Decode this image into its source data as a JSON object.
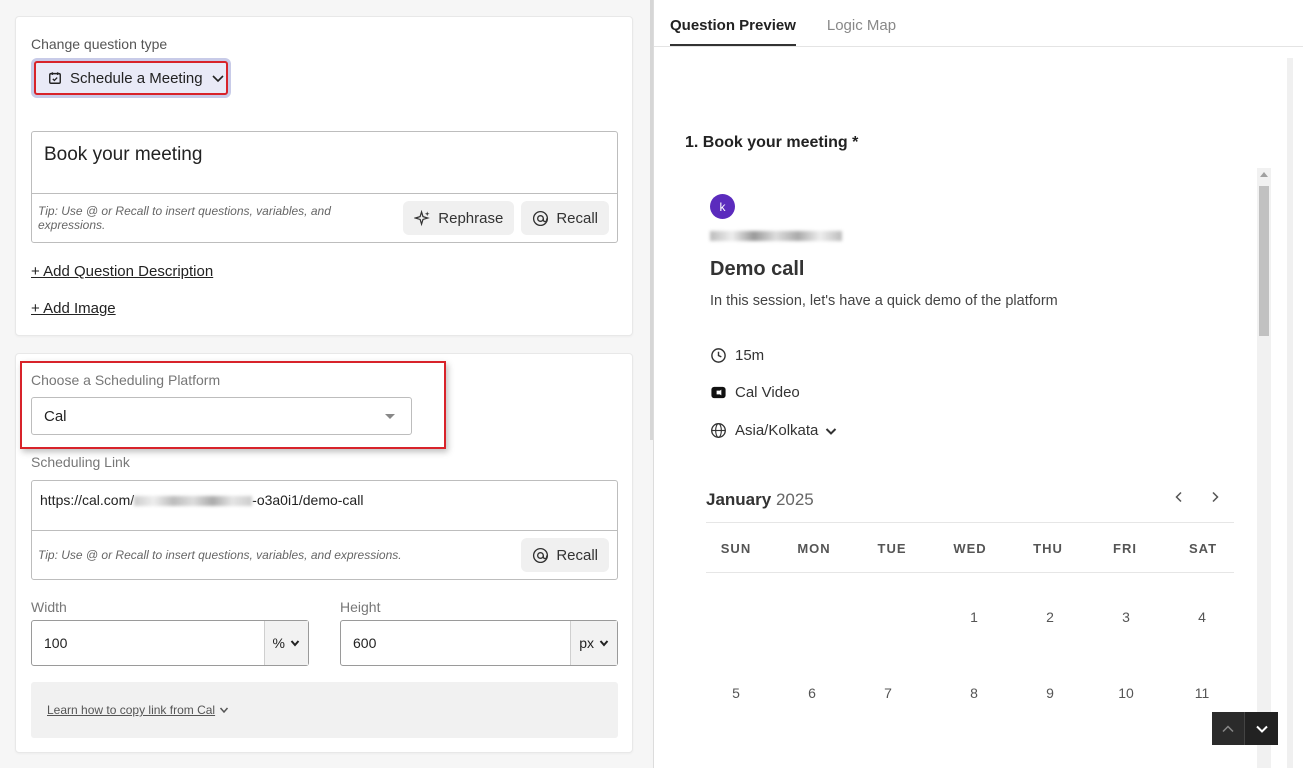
{
  "left": {
    "change_type_label": "Change question type",
    "type_button_label": "Schedule a Meeting",
    "question_text": "Book your meeting",
    "tip": "Tip: Use @ or Recall to insert questions, variables, and expressions.",
    "rephrase_label": "Rephrase",
    "recall_label": "Recall",
    "add_description": "+ Add Question Description",
    "add_image": "+ Add Image",
    "platform_label": "Choose a Scheduling Platform",
    "platform_value": "Cal",
    "scheduling_link_label": "Scheduling Link",
    "link_prefix": "https://cal.com/",
    "link_suffix": "-o3a0i1/demo-call",
    "width_label": "Width",
    "width_value": "100",
    "width_unit": "%",
    "height_label": "Height",
    "height_value": "600",
    "height_unit": "px",
    "help_link": "Learn how to copy link from Cal"
  },
  "right": {
    "tabs": [
      "Question Preview",
      "Logic Map"
    ],
    "question_title": "1. Book your meeting *",
    "avatar_letter": "k",
    "event_title": "Demo call",
    "event_desc": "In this session, let's have a quick demo of the platform",
    "duration": "15m",
    "location": "Cal Video",
    "timezone": "Asia/Kolkata",
    "month": "January",
    "year": "2025",
    "weekdays": [
      "SUN",
      "MON",
      "TUE",
      "WED",
      "THU",
      "FRI",
      "SAT"
    ],
    "week1": [
      "1",
      "2",
      "3",
      "4"
    ],
    "week2": [
      "5",
      "6",
      "7",
      "8",
      "9",
      "10",
      "11"
    ]
  }
}
